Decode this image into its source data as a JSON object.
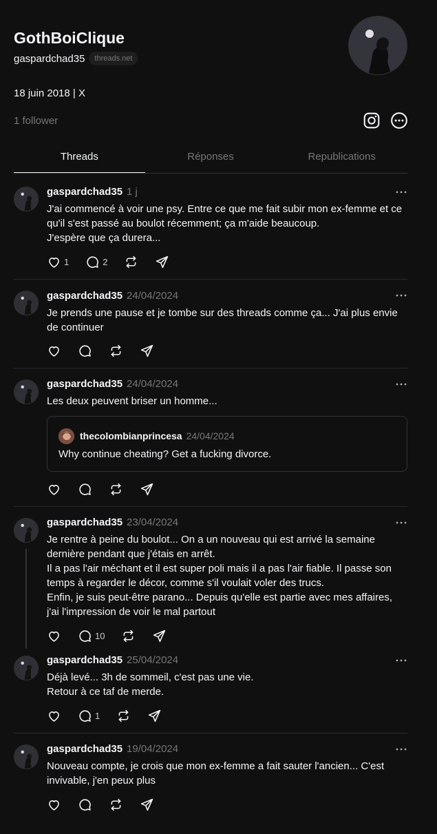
{
  "profile": {
    "name": "GothBoiClique",
    "handle": "gaspardchad35",
    "domain_badge": "threads.net",
    "bio": "18 juin 2018 | X",
    "followers": "1 follower"
  },
  "tabs": [
    {
      "label": "Threads",
      "active": true
    },
    {
      "label": "Réponses",
      "active": false
    },
    {
      "label": "Republications",
      "active": false
    }
  ],
  "posts": [
    {
      "author": "gaspardchad35",
      "time": "1 j",
      "text": "J'ai commencé à voir une psy. Entre ce que me fait subir mon ex-femme et ce qu'il s'est passé au boulot récemment; ça m'aide beaucoup.\nJ'espère que ça durera...",
      "likes": "1",
      "replies": "2"
    },
    {
      "author": "gaspardchad35",
      "time": "24/04/2024",
      "text": "Je prends une pause et je tombe sur des threads comme ça... J'ai plus envie de continuer",
      "likes": "",
      "replies": ""
    },
    {
      "author": "gaspardchad35",
      "time": "24/04/2024",
      "text": "Les deux peuvent briser un homme...",
      "quote": {
        "author": "thecolombianprincesa",
        "time": "24/04/2024",
        "text": "Why continue cheating? Get a fucking divorce."
      },
      "likes": "",
      "replies": ""
    },
    {
      "author": "gaspardchad35",
      "time": "23/04/2024",
      "text": "Je rentre à peine du boulot... On a un nouveau qui est arrivé la semaine dernière pendant que j'étais en arrêt.\nIl a pas l'air méchant et il est super poli mais il a pas l'air fiable. Il passe son temps à regarder le décor, comme s'il voulait voler des trucs.\nEnfin, je suis peut-être parano... Depuis qu'elle est partie avec mes affaires, j'ai l'impression de voir le mal partout",
      "likes": "",
      "replies": "10"
    },
    {
      "author": "gaspardchad35",
      "time": "25/04/2024",
      "text": "Déjà levé... 3h de sommeil, c'est pas une vie.\nRetour à ce taf de merde.",
      "likes": "",
      "replies": "1"
    },
    {
      "author": "gaspardchad35",
      "time": "19/04/2024",
      "text": "Nouveau compte, je crois que mon ex-femme a fait sauter l'ancien... C'est invivable, j'en peux plus",
      "likes": "",
      "replies": ""
    }
  ],
  "icons": {
    "header": [
      "instagram-icon",
      "more-circle-icon"
    ],
    "post_actions": [
      "heart-icon",
      "comment-icon",
      "repost-icon",
      "share-icon"
    ],
    "post_menu": "more-dots-icon"
  },
  "colors": {
    "background": "#101010",
    "text_primary": "#f3f5f7",
    "text_secondary": "#777777",
    "divider": "#2a2a2a"
  }
}
